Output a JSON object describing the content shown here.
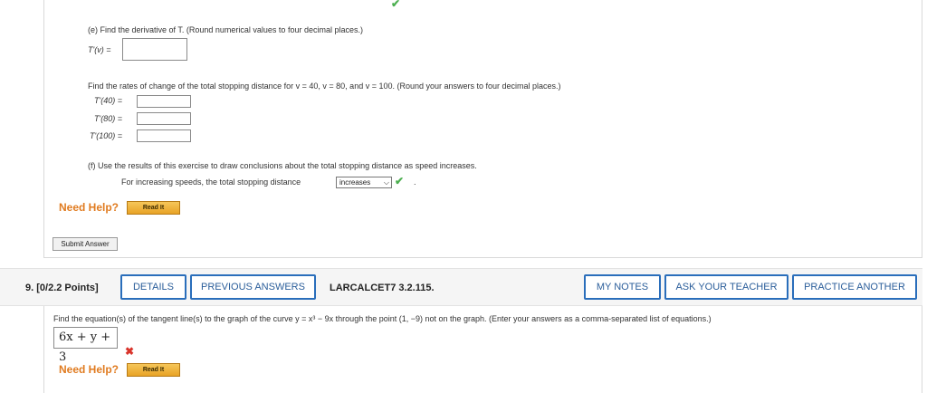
{
  "part_e": {
    "instruction": "(e) Find the derivative of T. (Round numerical values to four decimal places.)",
    "derivative_label": "T'(v) =",
    "derivative_value": ""
  },
  "rates": {
    "instruction": "Find the rates of change of the total stopping distance for v = 40, v = 80, and v = 100. (Round your answers to four decimal places.)",
    "items": [
      {
        "label": "T'(40) =",
        "value": ""
      },
      {
        "label": "T'(80) =",
        "value": ""
      },
      {
        "label": "T'(100) =",
        "value": ""
      }
    ]
  },
  "part_f": {
    "instruction": "(f) Use the results of this exercise to draw conclusions about the total stopping distance as speed increases.",
    "sentence": "For increasing speeds, the total stopping distance",
    "selected": "increases",
    "period": "."
  },
  "help1": {
    "label": "Need Help?",
    "read_button": "Read It"
  },
  "submit_button": "Submit Answer",
  "question9": {
    "number": "9.",
    "points": "[0/2.2 Points]",
    "details_button": "DETAILS",
    "previous_answers_button": "PREVIOUS ANSWERS",
    "reference": "LARCALCET7 3.2.115.",
    "my_notes_button": "MY NOTES",
    "ask_teacher_button": "ASK YOUR TEACHER",
    "practice_another_button": "PRACTICE ANOTHER",
    "prompt": "Find the equation(s) of the tangent line(s) to the graph of the curve y = x³ − 9x through the point (1, −9) not on the graph. (Enter your answers as a comma-separated list of equations.)",
    "answer": "6x + y + 3"
  },
  "help2": {
    "label": "Need Help?",
    "read_button": "Read It"
  },
  "colors": {
    "accent": "#2a6ebb",
    "help": "#e07b20",
    "correct": "#4caf50",
    "incorrect": "#d9342b"
  }
}
